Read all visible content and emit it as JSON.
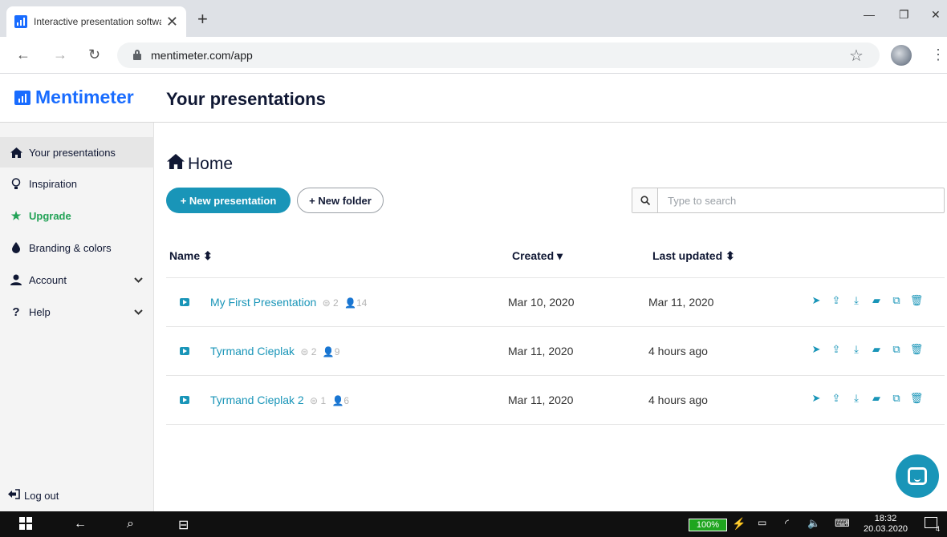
{
  "browser": {
    "tab_title": "Interactive presentation software",
    "url": "mentimeter.com/app"
  },
  "app": {
    "logo": "Mentimeter",
    "page_title": "Your presentations",
    "accent": "#1995b8",
    "brand": "#196cff"
  },
  "sidebar": {
    "items": [
      {
        "label": "Your presentations",
        "icon": "home-icon"
      },
      {
        "label": "Inspiration",
        "icon": "lightbulb-icon"
      },
      {
        "label": "Upgrade",
        "icon": "star-icon"
      },
      {
        "label": "Branding & colors",
        "icon": "drop-icon"
      },
      {
        "label": "Account",
        "icon": "user-icon"
      },
      {
        "label": "Help",
        "icon": "question-icon"
      }
    ],
    "logout": "Log out"
  },
  "main": {
    "heading": "Home",
    "new_presentation": "+ New presentation",
    "new_folder": "+ New folder",
    "search_placeholder": "Type to search",
    "columns": {
      "name": "Name",
      "created": "Created",
      "updated": "Last updated"
    },
    "rows": [
      {
        "name": "My First Presentation",
        "slides": "2",
        "responses": "14",
        "created": "Mar 10, 2020",
        "updated": "Mar 11, 2020"
      },
      {
        "name": "Tyrmand Cieplak",
        "slides": "2",
        "responses": "9",
        "created": "Mar 11, 2020",
        "updated": "4 hours ago"
      },
      {
        "name": "Tyrmand Cieplak 2",
        "slides": "1",
        "responses": "6",
        "created": "Mar 11, 2020",
        "updated": "4 hours ago"
      }
    ]
  },
  "taskbar": {
    "battery": "100%",
    "time": "18:32",
    "date": "20.03.2020",
    "notifications": "4"
  }
}
